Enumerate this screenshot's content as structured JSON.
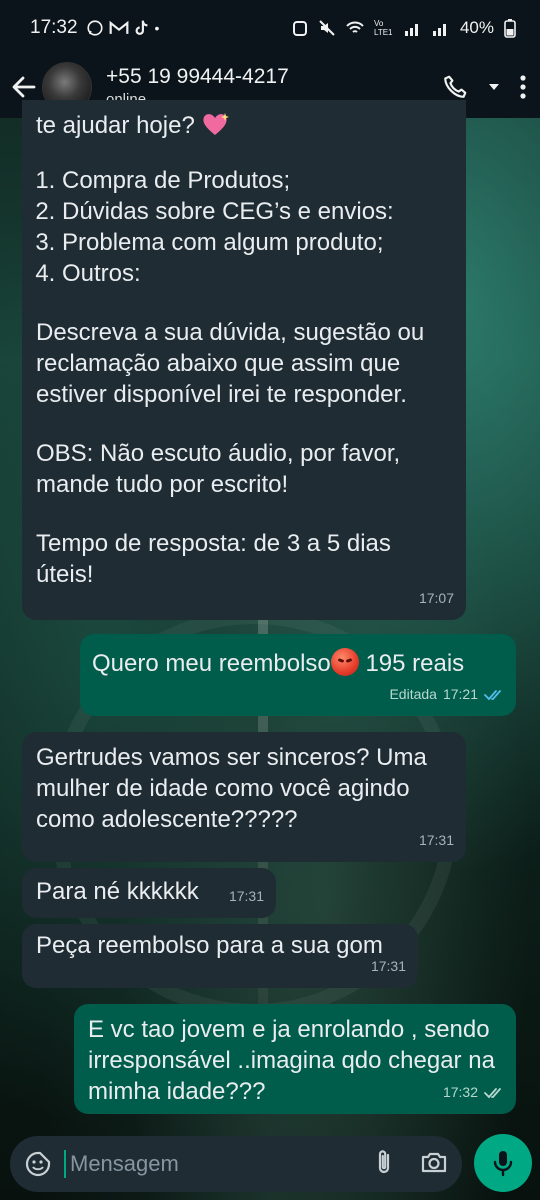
{
  "status_bar": {
    "time": "17:32",
    "battery": "40%",
    "network_label": "Vo LTE1"
  },
  "header": {
    "contact_name": "+55 19 99444-4217",
    "status": "online"
  },
  "messages": [
    {
      "direction": "incoming",
      "top_text": "te ajudar hoje?",
      "list": [
        "Compra de Produtos;",
        "Dúvidas sobre CEG’s e envios:",
        "Problema com algum produto;",
        "Outros:"
      ],
      "para1": "Descreva a sua dúvida, sugestão ou reclamação abaixo que assim que estiver disponível irei te responder.",
      "para2": "OBS: Não escuto áudio, por favor, mande tudo por escrito!",
      "para3": "Tempo de resposta: de 3 a 5 dias úteis!",
      "time": "17:07"
    },
    {
      "direction": "outgoing",
      "text_before": "Quero meu reembolso",
      "text_after": " 195 reais",
      "edited_label": "Editada",
      "time": "17:21"
    },
    {
      "direction": "incoming",
      "text": "Gertrudes vamos ser sinceros? Uma mulher de idade como você agindo como adolescente?????",
      "time": "17:31"
    },
    {
      "direction": "incoming",
      "text": "Para né kkkkkk",
      "time": "17:31"
    },
    {
      "direction": "incoming",
      "text": "Peça reembolso para a sua gom",
      "time": "17:31"
    },
    {
      "direction": "outgoing",
      "text": "E vc tao jovem e ja enrolando  , sendo irresponsável  ..imagina qdo chegar na mimha idade???",
      "time": "17:32"
    }
  ],
  "composer": {
    "placeholder": "Mensagem"
  },
  "colors": {
    "incoming_bubble": "#1f2c34",
    "outgoing_bubble": "#005c4b",
    "accent": "#00a884",
    "read_ticks": "#53bdeb"
  }
}
